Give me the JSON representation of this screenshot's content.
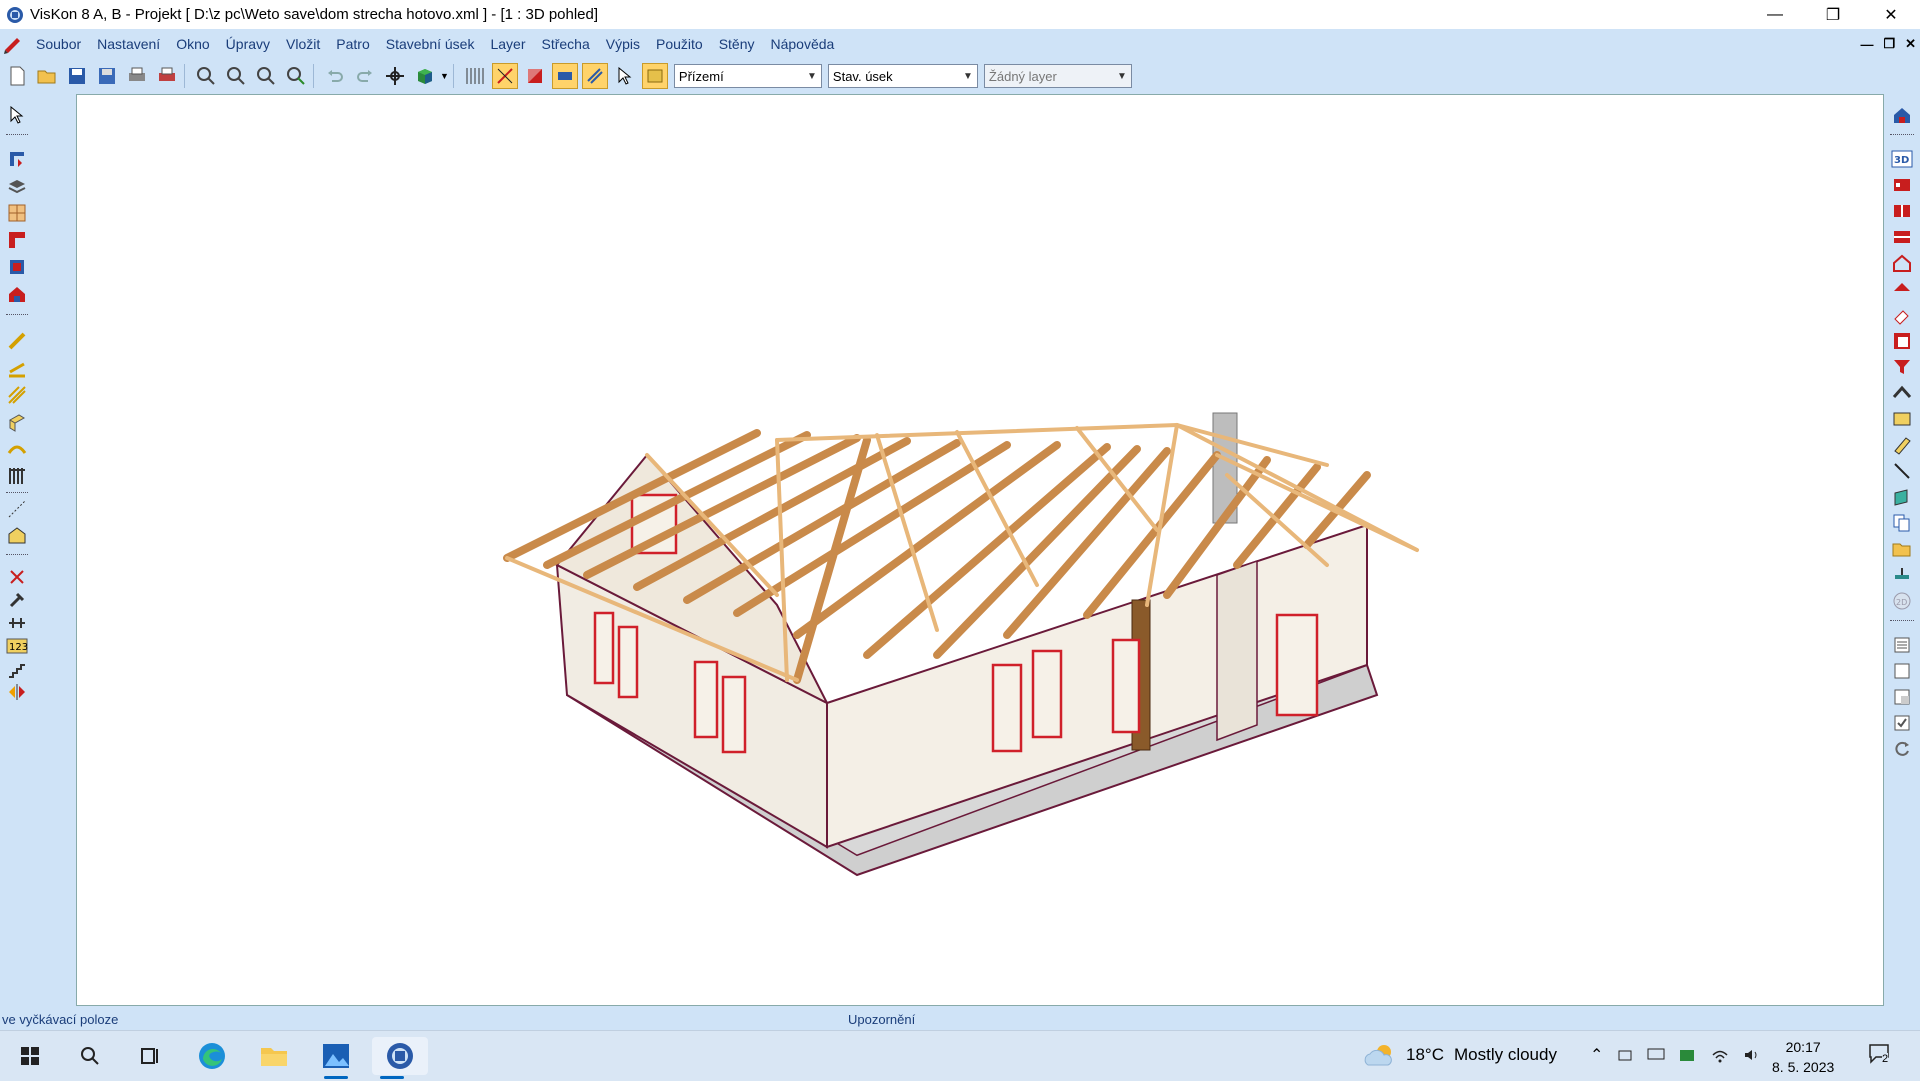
{
  "window": {
    "title": "VisKon 8 A, B - Projekt [ D:\\z pc\\Weto save\\dom strecha hotovo.xml ]  - [1 : 3D pohled]",
    "controls": [
      "minimize-icon",
      "restore-icon",
      "close-icon"
    ]
  },
  "menu": {
    "items": [
      "Soubor",
      "Nastavení",
      "Okno",
      "Úpravy",
      "Vložit",
      "Patro",
      "Stavební úsek",
      "Layer",
      "Střecha",
      "Výpis",
      "Použito",
      "Stěny",
      "Nápověda"
    ]
  },
  "toolbar": {
    "floor_combo": "Přízemí",
    "section_combo": "Stav. úsek",
    "layer_combo": "Žádný layer"
  },
  "status": {
    "left": "ve vyčkávací poloze",
    "center": "Upozornění"
  },
  "taskbar": {
    "weather_temp": "18°C",
    "weather_desc": "Mostly cloudy",
    "time": "20:17",
    "date": "8. 5. 2023",
    "notification_count": "2"
  },
  "colors": {
    "chrome": "#cfe3f7",
    "menu_text": "#1a3d7a",
    "wall": "#f3eee6",
    "timber": "#e8b77a",
    "window_frame": "#d0202a",
    "slab": "#d6d6d6"
  }
}
